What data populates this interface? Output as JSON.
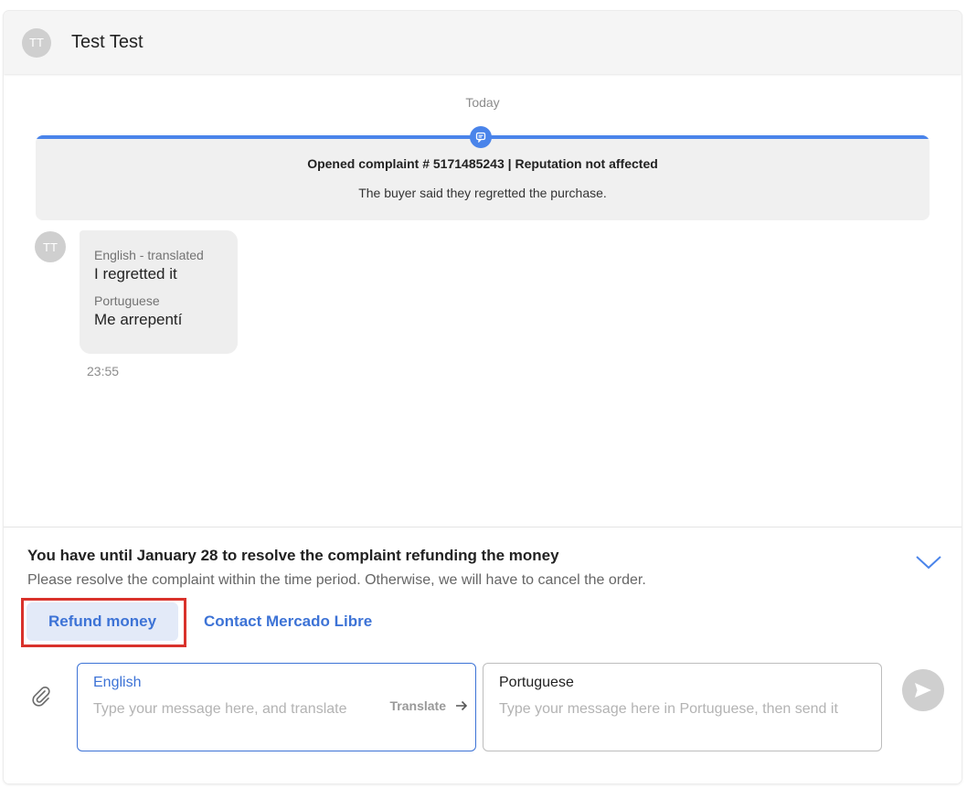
{
  "header": {
    "avatar_initials": "TT",
    "contact_name": "Test Test"
  },
  "conversation": {
    "date_separator": "Today",
    "event": {
      "title_prefix": "Opened complaint # 5171485243",
      "title_suffix": " | Reputation not affected",
      "description": "The buyer said they regretted the purchase.",
      "accent_color": "#4a84ea"
    },
    "message": {
      "avatar_initials": "TT",
      "translated_label": "English - translated",
      "translated_text": "I regretted it",
      "original_label": "Portuguese",
      "original_text": "Me arrepentí",
      "time": "23:55"
    }
  },
  "footer": {
    "resolve_title": "You have until January 28 to resolve the complaint refunding the money",
    "resolve_description": "Please resolve the complaint within the time period. Otherwise, we will have to cancel the order.",
    "refund_button": "Refund money",
    "contact_link": "Contact Mercado Libre",
    "highlight_color": "#d9322b"
  },
  "composer": {
    "english_label": "English",
    "english_placeholder": "Type your message here, and translate",
    "translate_button": "Translate",
    "portuguese_label": "Portuguese",
    "portuguese_placeholder": "Type your message here in Portuguese, then send it",
    "attach_icon": "paperclip-icon",
    "send_icon": "send-icon"
  }
}
